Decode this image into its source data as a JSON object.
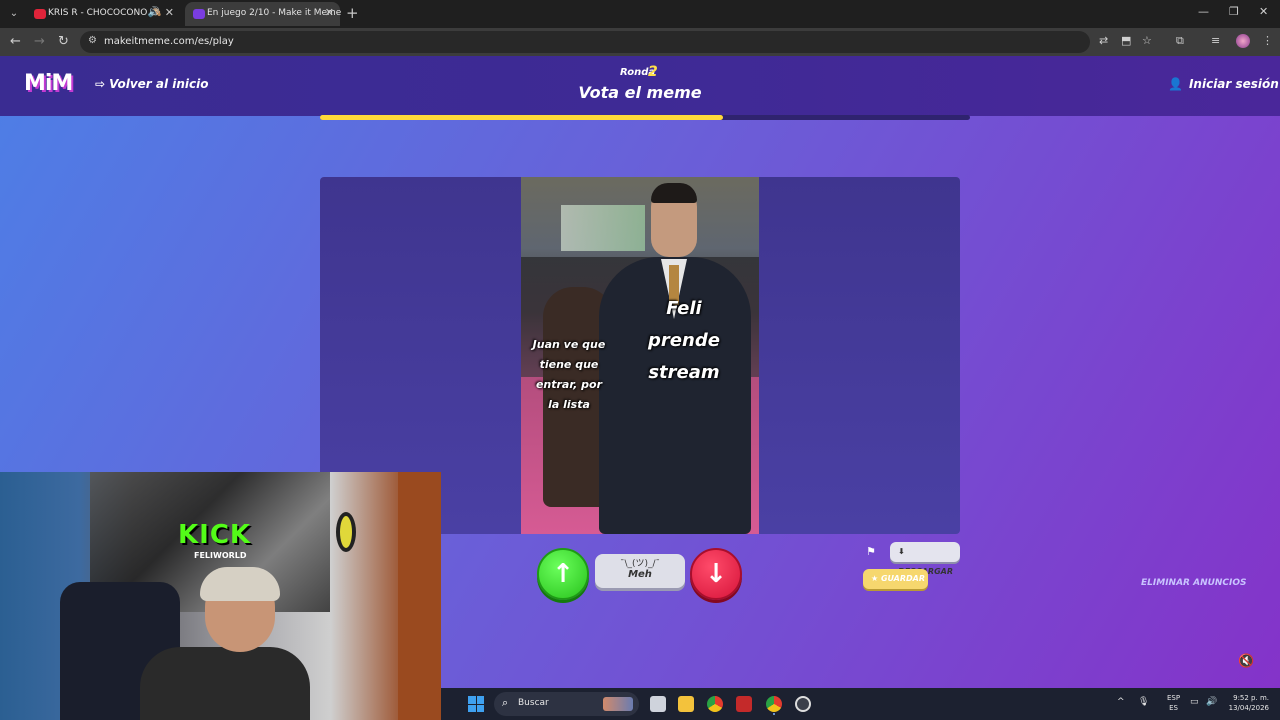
{
  "browser": {
    "tabs": [
      {
        "title": "KRIS R - CHOCOCONO 🙈",
        "active": false,
        "favicon_color": "#e0243a"
      },
      {
        "title": "En juego 2/10 - Make it Meme",
        "active": true,
        "favicon_color": "#7a3de0"
      }
    ],
    "url": "makeitmeme.com/es/play"
  },
  "header": {
    "logo": "MiM",
    "back_label": "Volver al inicio",
    "round_label": "Ronda",
    "round_number": "2",
    "phase_title": "Vota el meme",
    "login_label": "Iniciar sesión",
    "progress": 0.62
  },
  "meme": {
    "caption_left": "Juan ve que tiene que entrar, por la lista",
    "caption_right": "Feli prende stream"
  },
  "vote": {
    "meh_face": "¯\\_(ツ)_/¯",
    "meh_label": "Meh"
  },
  "actions": {
    "download_label": "DESCARGAR",
    "save_label": "GUARDAR",
    "remove_ads_label": "ELIMINAR ANUNCIOS"
  },
  "webcam": {
    "brand": "KICK",
    "brand_sub": "FELIWORLD"
  },
  "taskbar": {
    "search_placeholder": "Buscar",
    "lang_top": "ESP",
    "lang_bottom": "ES",
    "time": "9:52 p. m.",
    "date": "13/04/2026"
  },
  "colors": {
    "accent_yellow": "#ffd93a",
    "vote_up": "#28c21c",
    "vote_down": "#d6143a",
    "kick_green": "#53fc18"
  }
}
